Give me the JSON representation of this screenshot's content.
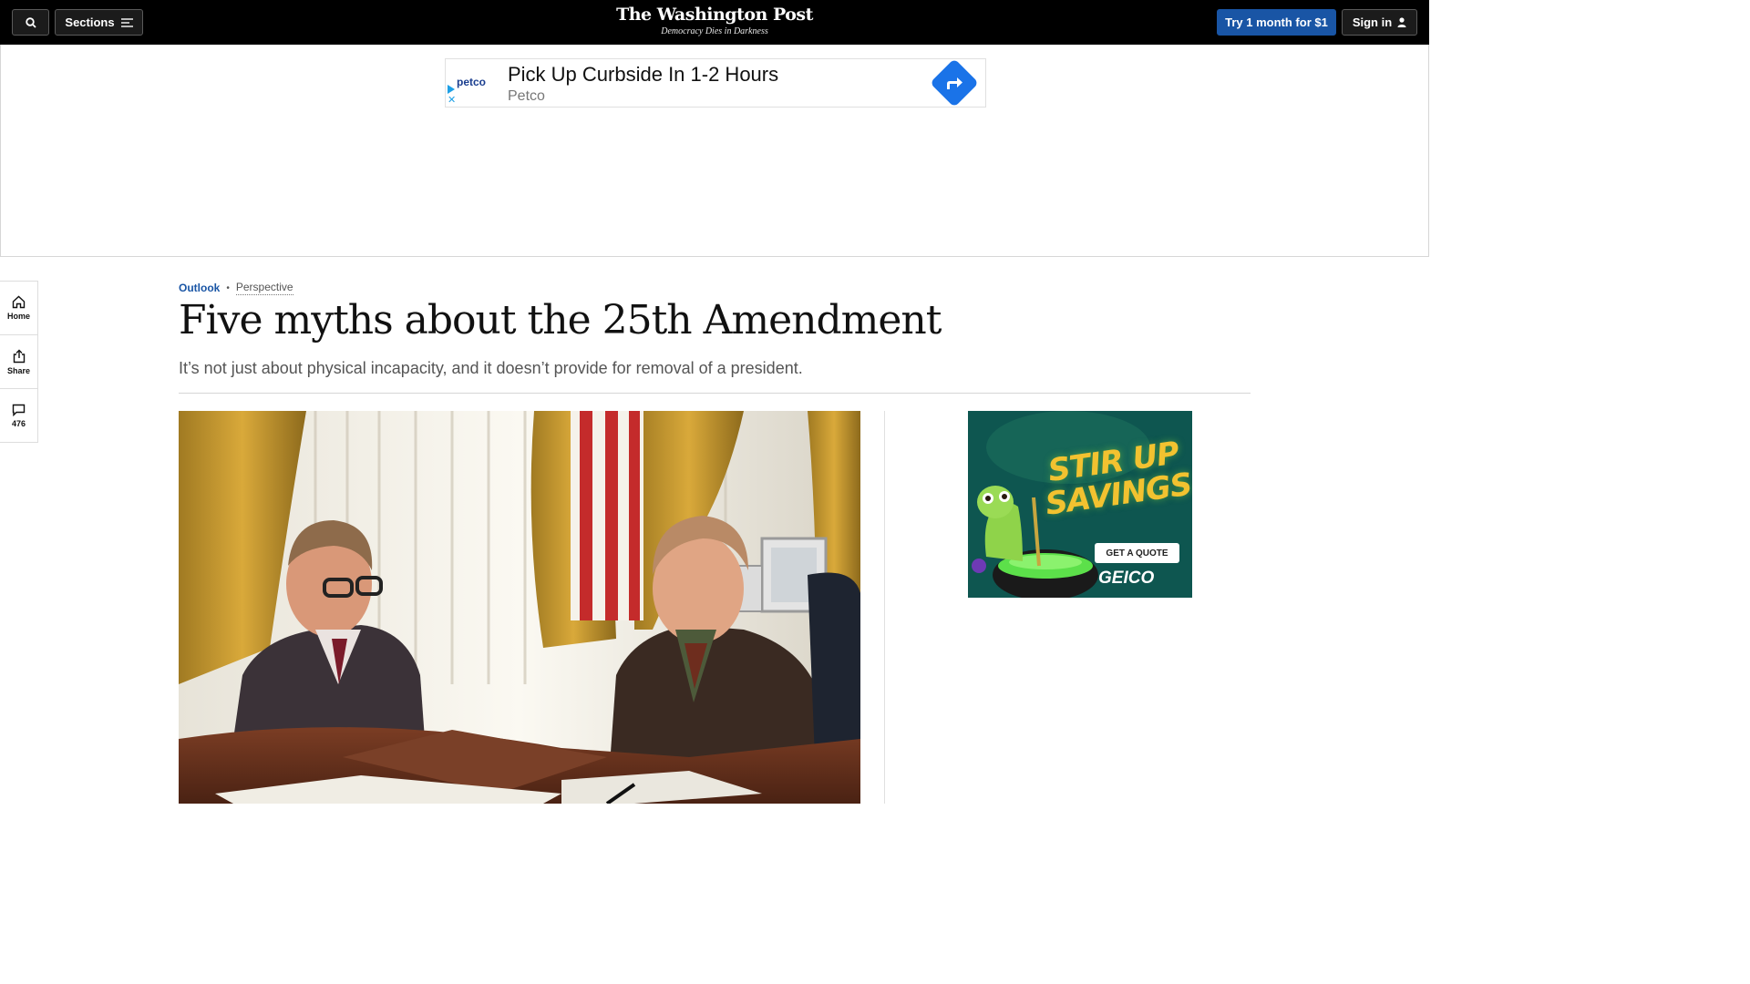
{
  "nav": {
    "search_icon": "search-icon",
    "sections_label": "Sections",
    "subscribe_label": "Try 1 month for $1",
    "signin_label": "Sign in",
    "colors": {
      "bar": "#000000",
      "subscribe": "#1955a5"
    }
  },
  "masthead": {
    "logo": "The Washington Post",
    "tagline": "Democracy Dies in Darkness"
  },
  "banner_ad": {
    "brand_logo": "petco",
    "headline": "Pick Up Curbside In 1-2 Hours",
    "brand": "Petco"
  },
  "side_rail": {
    "home_label": "Home",
    "share_label": "Share",
    "comments_count": "476"
  },
  "article": {
    "section": "Outlook",
    "label": "Perspective",
    "headline": "Five myths about the 25th Amendment",
    "dek": "It’s not just about physical incapacity, and it doesn’t provide for removal of a president."
  },
  "side_ad": {
    "headline": "STIR UP SAVINGS",
    "cta": "GET A QUOTE",
    "brand": "GEICO"
  }
}
